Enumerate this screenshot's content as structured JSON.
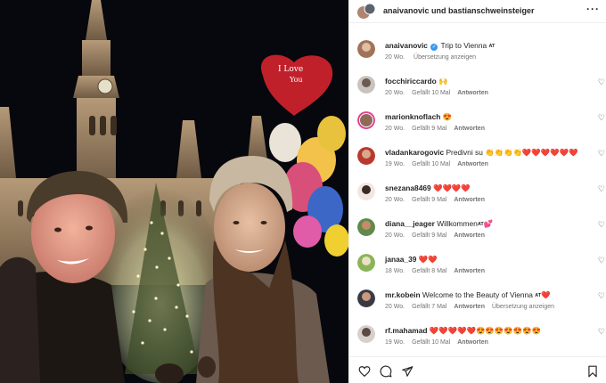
{
  "header": {
    "title": "anaivanovic und bastianschweinsteiger",
    "more_icon": "more-horizontal-icon"
  },
  "caption": {
    "user": "anaivanovic",
    "text": "Trip to Vienna",
    "tag": "AT",
    "time": "20 Wo.",
    "translate": "Übersetzung anzeigen"
  },
  "comments": [
    {
      "user": "focchiriccardo",
      "text": "🙌",
      "time": "20 Wo.",
      "likes": "Gefällt 10 Mal",
      "reply": "Antworten"
    },
    {
      "user": "marionknoflach",
      "text": "😍",
      "time": "20 Wo.",
      "likes": "Gefällt 9 Mal",
      "reply": "Antworten"
    },
    {
      "user": "vladankarogovic",
      "text": "Predivni su 👏👏👏👏❤️❤️❤️❤️❤️❤️",
      "time": "19 Wo.",
      "likes": "Gefällt 10 Mal",
      "reply": "Antworten"
    },
    {
      "user": "snezana8469",
      "text": "❤️❤️❤️❤️",
      "time": "20 Wo.",
      "likes": "Gefällt 9 Mal",
      "reply": "Antworten"
    },
    {
      "user": "diana__jeager",
      "text": "Willkommen",
      "tag": "AT",
      "text2": "💕",
      "time": "20 Wo.",
      "likes": "Gefällt 9 Mal",
      "reply": "Antworten"
    },
    {
      "user": "janaa_39",
      "text": "❤️❤️",
      "time": "18 Wo.",
      "likes": "Gefällt 8 Mal",
      "reply": "Antworten"
    },
    {
      "user": "mr.kobein",
      "text": "Welcome to the Beauty of Vienna",
      "tag": "AT",
      "text2": "❤️",
      "time": "20 Wo.",
      "likes": "Gefällt 7 Mal",
      "reply": "Antworten",
      "translate": "Übersetzung anzeigen"
    },
    {
      "user": "rf.mahamad",
      "text": "❤️❤️❤️❤️❤️😍😍😍😍😍😍😍",
      "time": "19 Wo.",
      "likes": "Gefällt 10 Mal",
      "reply": "Antworten"
    }
  ],
  "actions": {
    "like_icon": "heart-icon",
    "comment_icon": "comment-icon",
    "share_icon": "share-icon",
    "save_icon": "bookmark-icon"
  },
  "colors": {
    "verified": "#3897f0",
    "meta": "#737373",
    "divider": "#efefef"
  }
}
